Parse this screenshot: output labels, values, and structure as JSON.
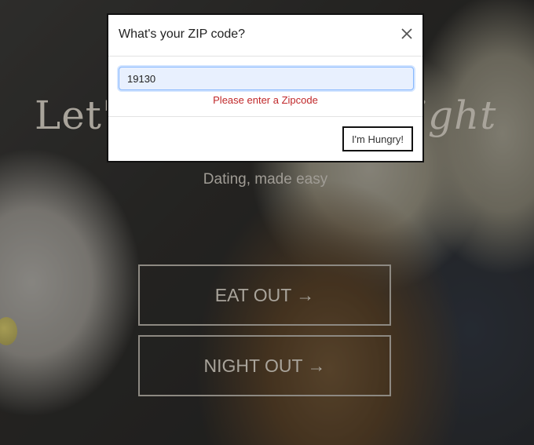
{
  "background": {
    "hero_title_left": "Let'",
    "hero_title_right": "ight",
    "tagline": "Dating, made easy",
    "eat_out_label": "EAT OUT →",
    "night_out_label": "NIGHT OUT →"
  },
  "modal": {
    "title": "What's your ZIP code?",
    "close_icon": "close-icon",
    "zip_value": "19130",
    "error_message": "Please enter a Zipcode",
    "submit_label": "I'm Hungry!"
  },
  "colors": {
    "error": "#c0282a",
    "input_focus_border": "#86b7fe",
    "input_autofill_bg": "#e8f0fe"
  }
}
